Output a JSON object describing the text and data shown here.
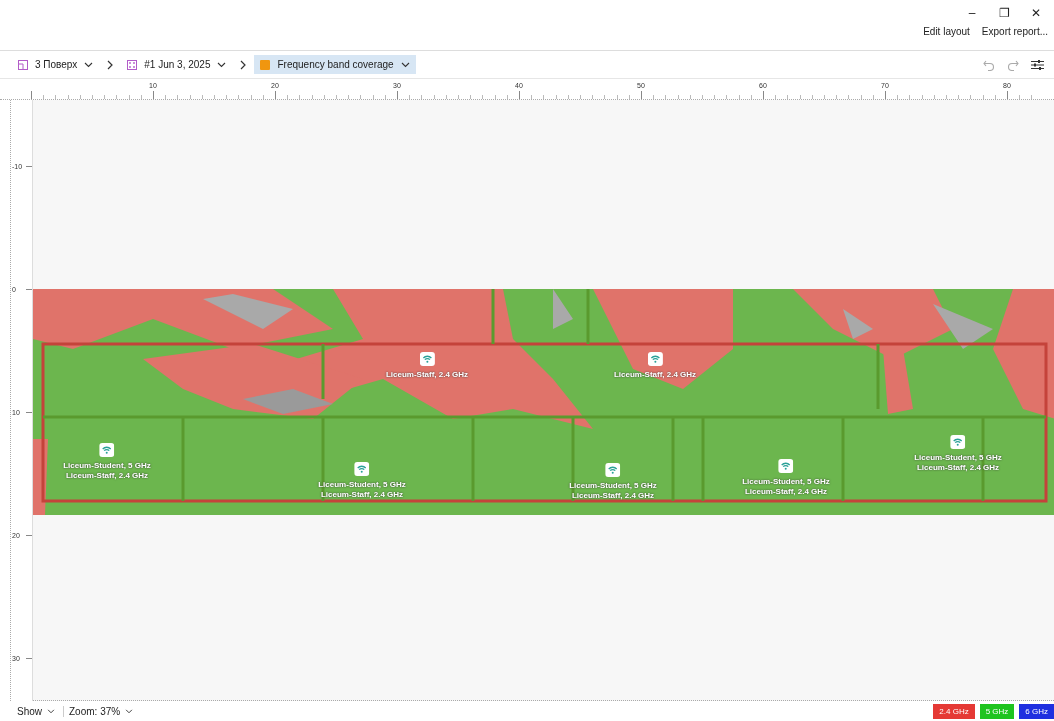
{
  "window": {
    "controls": [
      "–",
      "❐",
      "✕"
    ]
  },
  "header_actions": [
    "Edit layout",
    "Export report..."
  ],
  "breadcrumb": [
    {
      "kind": "floor",
      "label": "3 Поверх",
      "selected": false
    },
    {
      "kind": "survey",
      "label": "#1 Jun 3, 2025",
      "selected": false
    },
    {
      "kind": "view",
      "label": "Frequency band coverage",
      "selected": true
    }
  ],
  "ruler": {
    "x_labels": [
      "10",
      "20",
      "30",
      "40",
      "50",
      "60",
      "70",
      "80"
    ],
    "y_labels": [
      "-10",
      "0",
      "10",
      "20",
      "30"
    ]
  },
  "access_points": [
    {
      "labels": [
        "Liceum-Staff, 2.4 GHz"
      ]
    },
    {
      "labels": [
        "Liceum-Staff, 2.4 GHz"
      ]
    },
    {
      "labels": [
        "Liceum-Student, 5 GHz",
        "Liceum-Staff, 2.4 GHz"
      ]
    },
    {
      "labels": [
        "Liceum-Student, 5 GHz",
        "Liceum-Staff, 2.4 GHz"
      ]
    },
    {
      "labels": [
        "Liceum-Student, 5 GHz",
        "Liceum-Staff, 2.4 GHz"
      ]
    },
    {
      "labels": [
        "Liceum-Student, 5 GHz",
        "Liceum-Staff, 2.4 GHz"
      ]
    },
    {
      "labels": [
        "Liceum-Student, 5 GHz",
        "Liceum-Staff, 2.4 GHz"
      ]
    }
  ],
  "status_bar": {
    "show": "Show",
    "zoom": "Zoom: 37%"
  },
  "legend": [
    {
      "label": "2.4 GHz",
      "color": "#e53935"
    },
    {
      "label": "5 GHz",
      "color": "#1fc41f"
    },
    {
      "label": "6 GHz",
      "color": "#1f2fe0"
    }
  ]
}
